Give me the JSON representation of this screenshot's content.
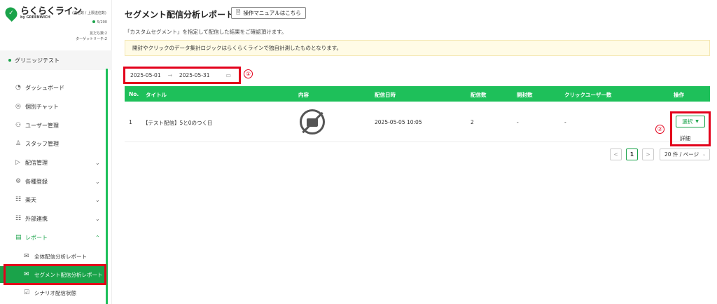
{
  "sidebar": {
    "logo_text": "らくらくライン",
    "logo_sub": "by GREENWICH",
    "logo_caption": "(送信数 / 上限送信数)",
    "send_count": "5/200",
    "friends": "友だち数:2",
    "target_reach": "ターゲットリーチ:2",
    "account": "グリニッジテスト",
    "items": [
      {
        "label": "ダッシュボード",
        "icon": "dashboard-icon",
        "glyph": "◔"
      },
      {
        "label": "個別チャット",
        "icon": "chat-icon",
        "glyph": "◎"
      },
      {
        "label": "ユーザー管理",
        "icon": "users-icon",
        "glyph": "⚇"
      },
      {
        "label": "スタッフ管理",
        "icon": "staff-icon",
        "glyph": "♙"
      },
      {
        "label": "配信管理",
        "icon": "send-icon",
        "glyph": "▷"
      },
      {
        "label": "各種登録",
        "icon": "settings-icon",
        "glyph": "⚙"
      },
      {
        "label": "楽天",
        "icon": "rakuten-icon",
        "glyph": "☷"
      },
      {
        "label": "外部連携",
        "icon": "link-icon",
        "glyph": "☷"
      },
      {
        "label": "レポート",
        "icon": "report-icon",
        "glyph": "▤"
      }
    ],
    "sub_items": [
      {
        "label": "全体配信分析レポート",
        "icon": "mail-icon",
        "glyph": "✉"
      },
      {
        "label": "セグメント配信分析レポート",
        "icon": "mail-icon",
        "glyph": "✉"
      },
      {
        "label": "シナリオ配信状態",
        "icon": "scenario-icon",
        "glyph": "☑"
      }
    ]
  },
  "header": {
    "title": "セグメント配信分析レポート",
    "manual_button": "操作マニュアルはこちら",
    "description": "「カスタムセグメント」を指定して配信した結果をご確認頂けます。",
    "notice": "開封やクリックのデータ集計ロジックはらくらくラインで独自計測したものとなります。"
  },
  "filter": {
    "start_date": "2025-05-01",
    "arrow": "→",
    "end_date": "2025-05-31"
  },
  "annotations": {
    "one": "①",
    "two": "②"
  },
  "table": {
    "headers": [
      "No.",
      "タイトル",
      "内容",
      "配信日時",
      "配信数",
      "開封数",
      "クリックユーザー数",
      "操作"
    ],
    "rows": [
      {
        "no": "1",
        "title": "【テスト配信】5と0のつく日",
        "date": "2025-05-05 10:05",
        "sent": "2",
        "opened": "-",
        "clicks": "-"
      }
    ],
    "select_button": "選択",
    "detail": "詳細"
  },
  "pagination": {
    "prev": "<",
    "page": "1",
    "next": ">",
    "page_size": "20 件 / ページ"
  },
  "colors": {
    "accent": "#1ec05a",
    "highlight": "#e3001b"
  }
}
